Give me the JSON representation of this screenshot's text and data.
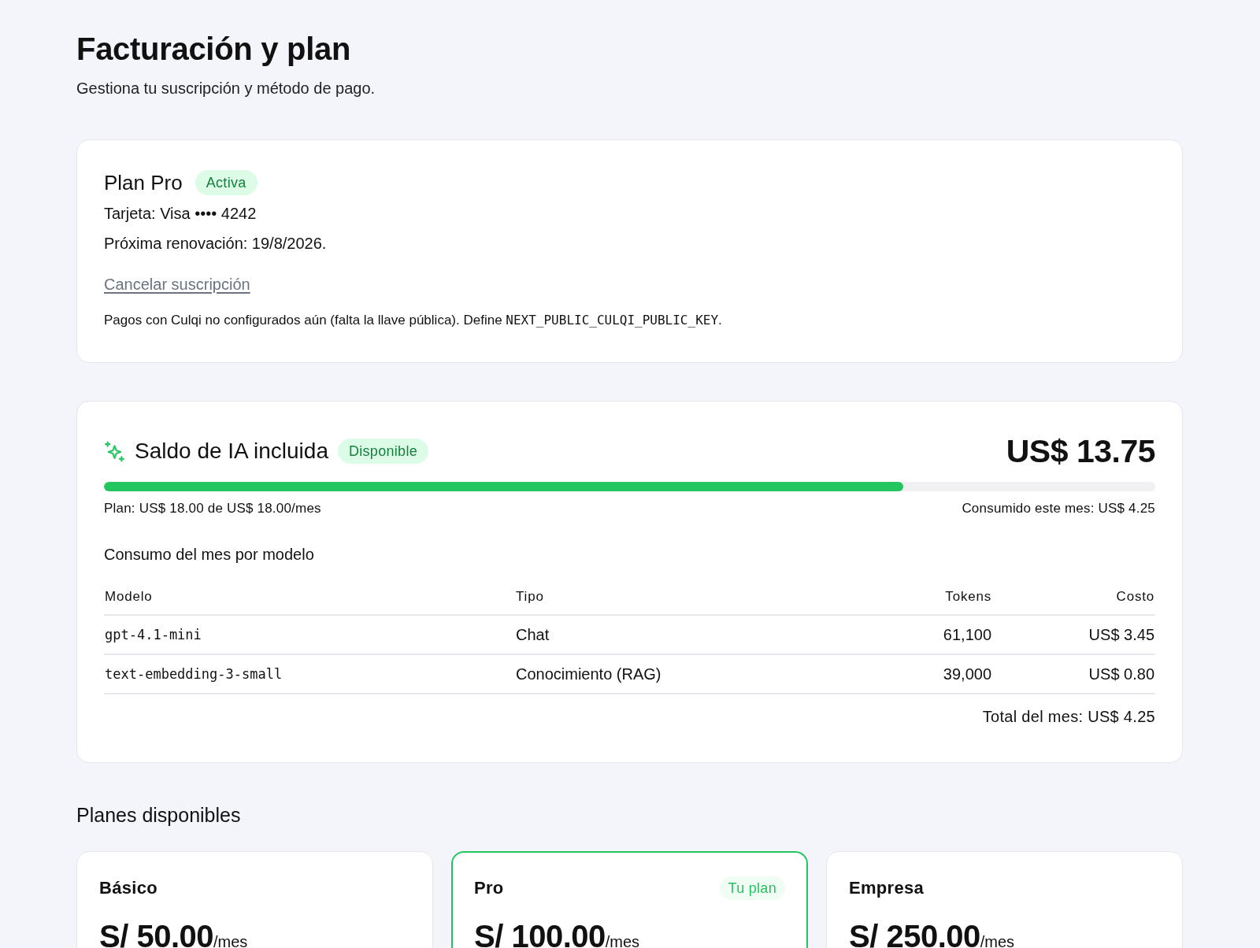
{
  "page": {
    "title": "Facturación y plan",
    "subtitle": "Gestiona tu suscripción y método de pago."
  },
  "subscription": {
    "plan_name": "Plan Pro",
    "status": "Activa",
    "card": "Tarjeta: Visa •••• 4242",
    "renewal": "Próxima renovación: 19/8/2026.",
    "cancel_link": "Cancelar suscripción",
    "notice": {
      "text": "Pagos con Culqi no configurados aún (falta la llave pública). Define ",
      "code": "NEXT_PUBLIC_CULQI_PUBLIC_KEY",
      "end": "."
    }
  },
  "ai_balance": {
    "title": "Saldo de IA incluida",
    "status": "Disponible",
    "amount": "US$ 13.75",
    "level": 0.76,
    "plan_note": "Plan: US$ 18.00 de US$ 18.00/mes",
    "consumed": "Consumido este mes: US$ 4.25",
    "usage_title": "Consumo del mes por modelo",
    "table": {
      "columns": [
        "Modelo",
        "Tipo",
        "Tokens",
        "Costo"
      ],
      "rows": [
        [
          "gpt-4.1-mini",
          "Chat",
          "61,100",
          "US$ 3.45"
        ],
        [
          "text-embedding-3-small",
          "Conocimiento (RAG)",
          "39,000",
          "US$ 0.80"
        ]
      ]
    },
    "total": "Total del mes: US$ 4.25"
  },
  "plans": {
    "title": "Planes disponibles",
    "items": [
      {
        "name": "Básico",
        "price": "S/ 50.00",
        "period": "/mes",
        "selected": false
      },
      {
        "name": "Pro",
        "price": "S/ 100.00",
        "period": "/mes",
        "selected": true,
        "badge": "Tu plan"
      },
      {
        "name": "Empresa",
        "price": "S/ 250.00",
        "period": "/mes",
        "selected": false
      }
    ]
  }
}
